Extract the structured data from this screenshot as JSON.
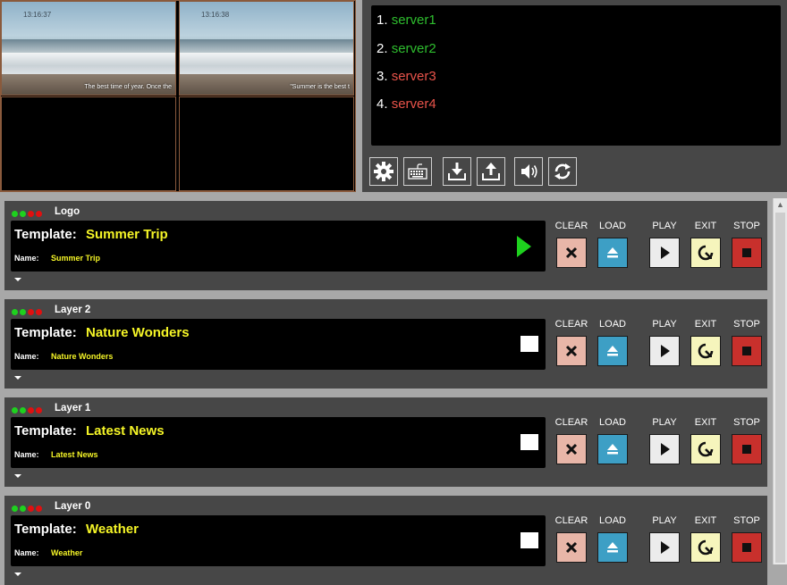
{
  "previews": [
    {
      "time": "13:16:37",
      "caption": "The best time of year. Once the"
    },
    {
      "time": "13:16:38",
      "caption": "\"Summer is the best t"
    }
  ],
  "servers": [
    {
      "index": "1.",
      "name": "server1",
      "status": "online"
    },
    {
      "index": "2.",
      "name": "server2",
      "status": "online"
    },
    {
      "index": "3.",
      "name": "server3",
      "status": "offline"
    },
    {
      "index": "4.",
      "name": "server4",
      "status": "offline"
    }
  ],
  "toolbar": {
    "icons": [
      "gear-icon",
      "keyboard-icon",
      "download-icon",
      "upload-icon",
      "volume-icon",
      "refresh-icon"
    ]
  },
  "controls": {
    "clear_label": "CLEAR",
    "load_label": "LOAD",
    "play_label": "PLAY",
    "exit_label": "EXIT",
    "stop_label": "STOP"
  },
  "layers": [
    {
      "title": "Logo",
      "template_label": "Template:",
      "template": "Summer Trip",
      "name_label": "Name:",
      "name": "Summer Trip",
      "state": "playing",
      "dots": [
        "green",
        "green",
        "red",
        "red"
      ]
    },
    {
      "title": "Layer 2",
      "template_label": "Template:",
      "template": "Nature Wonders",
      "name_label": "Name:",
      "name": "Nature Wonders",
      "state": "stopped",
      "dots": [
        "green",
        "green",
        "red",
        "red"
      ]
    },
    {
      "title": "Layer 1",
      "template_label": "Template:",
      "template": "Latest News",
      "name_label": "Name:",
      "name": "Latest News",
      "state": "stopped",
      "dots": [
        "green",
        "green",
        "red",
        "red"
      ]
    },
    {
      "title": "Layer 0",
      "template_label": "Template:",
      "template": "Weather",
      "name_label": "Name:",
      "name": "Weather",
      "state": "stopped",
      "dots": [
        "green",
        "green",
        "red",
        "red"
      ]
    }
  ],
  "colors": {
    "online": "#2ebd2e",
    "offline": "#e8534a",
    "template_text": "#f5f527",
    "panel_bg": "#474747"
  }
}
